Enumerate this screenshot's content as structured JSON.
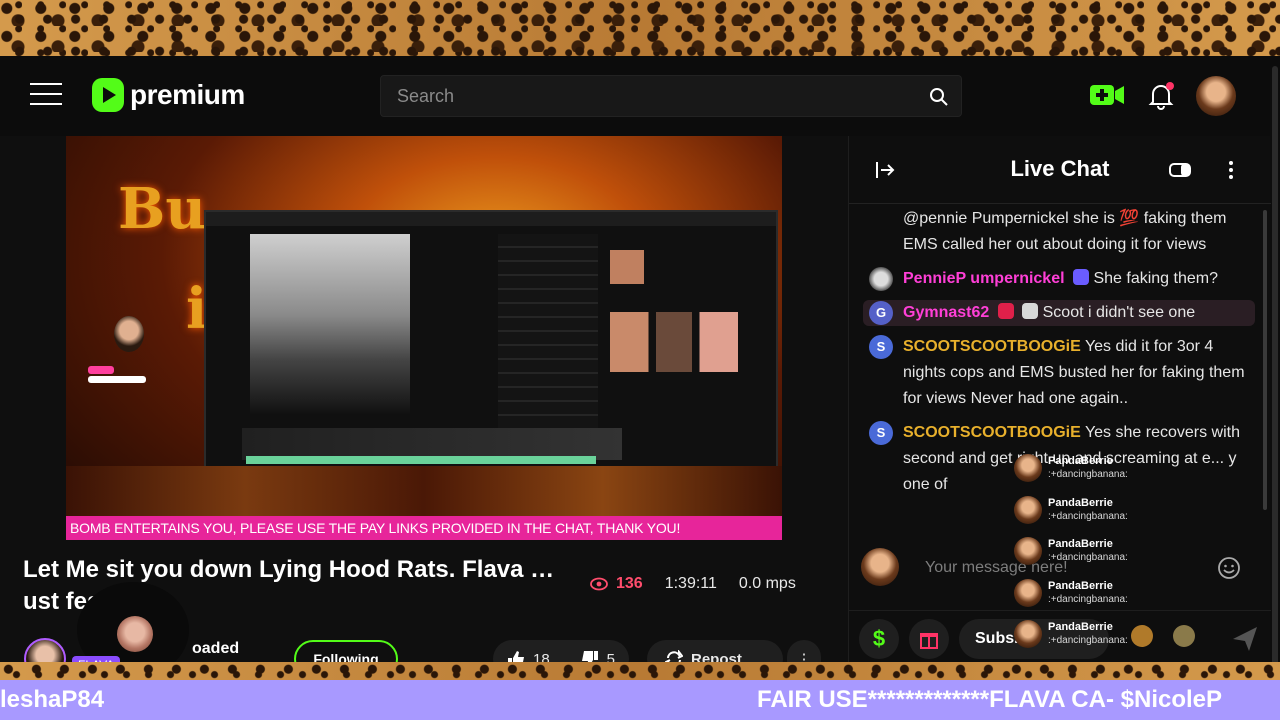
{
  "header": {
    "logo_text": "premium",
    "search_placeholder": "Search"
  },
  "video": {
    "overlay_text_1": "Bu",
    "overlay_text_2": "i",
    "banner": "BOMB ENTERTAINS YOU, PLEASE USE THE PAY LINKS PROVIDED IN THE CHAT, THANK YOU!"
  },
  "stream": {
    "title": "Let Me sit you down Lying Hood Rats. Flava … ust fess up.",
    "viewers": "136",
    "uptime": "1:39:11",
    "mps": "0.0 mps",
    "channel_partial": "oaded",
    "badge": "FLAVA",
    "follow_label": "Following",
    "likes": "18",
    "dislikes": "5",
    "repost_label": "Repost",
    "more_glyph": "⋮"
  },
  "chat": {
    "title": "Live Chat",
    "messages": [
      {
        "text": "@pennie Pumpernickel she is 💯 faking them EMS called her out about doing it for views"
      },
      {
        "user": "PennieP umpernickel",
        "text": "She faking them?"
      },
      {
        "avatar_letter": "G",
        "user": "Gymnast62",
        "text": "Scoot i didn't see one"
      },
      {
        "avatar_letter": "S",
        "user": "SCOOTSCOOTBOOGiE",
        "text": "Yes did it for 3or 4 nights cops and EMS busted her for faking them for views Never had one again.."
      },
      {
        "avatar_letter": "S",
        "user": "SCOOTSCOOTBOOGiE",
        "text": "Yes she recovers with second and get right up and screaming at e... y one of"
      }
    ],
    "input_placeholder": "Your message here!",
    "dollar_glyph": "$",
    "subscribe_label": "Subs...",
    "overlay_feed": [
      {
        "name": "PandaBerrie",
        "text": ":+dancingbanana:"
      },
      {
        "name": "PandaBerrie",
        "text": ":+dancingbanana:"
      },
      {
        "name": "PandaBerrie",
        "text": ":+dancingbanana:"
      },
      {
        "name": "PandaBerrie",
        "text": ":+dancingbanana:"
      },
      {
        "name": "PandaBerrie",
        "text": ":+dancingbanana:"
      }
    ]
  },
  "ticker": {
    "left": "leshaP84",
    "right": "FAIR USE*************FLAVA CA- $NicoleP"
  },
  "colors": {
    "brand": "#53fc18",
    "banner": "#e7259a",
    "ticker": "#a899ff",
    "viewer_count": "#ff4d6d",
    "username_pink": "#ff3fd7",
    "username_orange": "#e8b02c"
  },
  "icons": [
    "menu-icon",
    "play-logo-icon",
    "search-icon",
    "camera-plus-icon",
    "bell-icon",
    "eye-icon",
    "thumb-up-icon",
    "thumb-down-icon",
    "repost-icon",
    "more-icon",
    "collapse-chat-icon",
    "popout-icon",
    "emoji-icon",
    "dollar-icon",
    "gift-icon",
    "send-icon"
  ]
}
